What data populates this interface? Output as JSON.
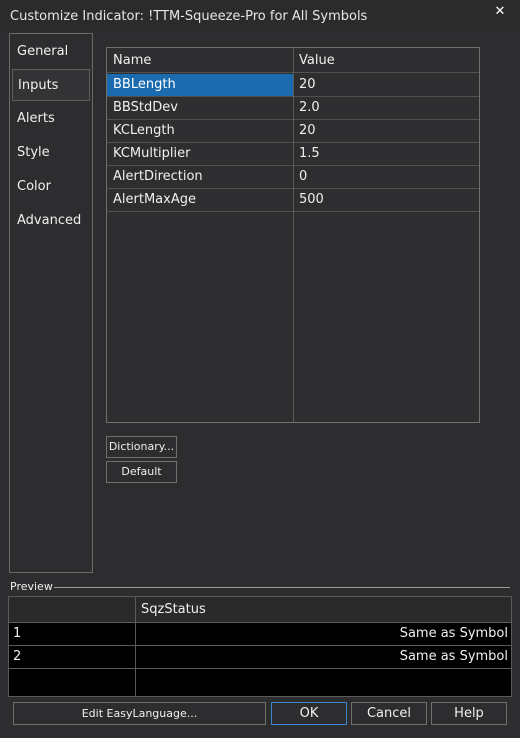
{
  "window": {
    "title": "Customize Indicator: !TTM-Squeeze-Pro for All Symbols",
    "close_glyph": "✕"
  },
  "nav": {
    "items": [
      {
        "label": "General"
      },
      {
        "label": "Inputs"
      },
      {
        "label": "Alerts"
      },
      {
        "label": "Style"
      },
      {
        "label": "Color"
      },
      {
        "label": "Advanced"
      }
    ],
    "selected": "Inputs"
  },
  "inputs_grid": {
    "columns": {
      "name": "Name",
      "value": "Value"
    },
    "rows": [
      {
        "name": "BBLength",
        "value": "20"
      },
      {
        "name": "BBStdDev",
        "value": "2.0"
      },
      {
        "name": "KCLength",
        "value": "20"
      },
      {
        "name": "KCMultiplier",
        "value": "1.5"
      },
      {
        "name": "AlertDirection",
        "value": "0"
      },
      {
        "name": "AlertMaxAge",
        "value": "500"
      }
    ],
    "selected_row": "BBLength"
  },
  "buttons": {
    "dictionary": "Dictionary...",
    "default": "Default",
    "edit_easylanguage": "Edit EasyLanguage...",
    "ok": "OK",
    "cancel": "Cancel",
    "help": "Help"
  },
  "preview": {
    "label": "Preview",
    "column_header": "SqzStatus",
    "rows": [
      {
        "num": "1",
        "value": "Same as Symbol"
      },
      {
        "num": "2",
        "value": "Same as Symbol"
      }
    ]
  },
  "colors": {
    "background": "#2d2d30",
    "selection": "#1b6bb0",
    "primary_border": "#3c86d0",
    "preview_background": "#000000"
  }
}
